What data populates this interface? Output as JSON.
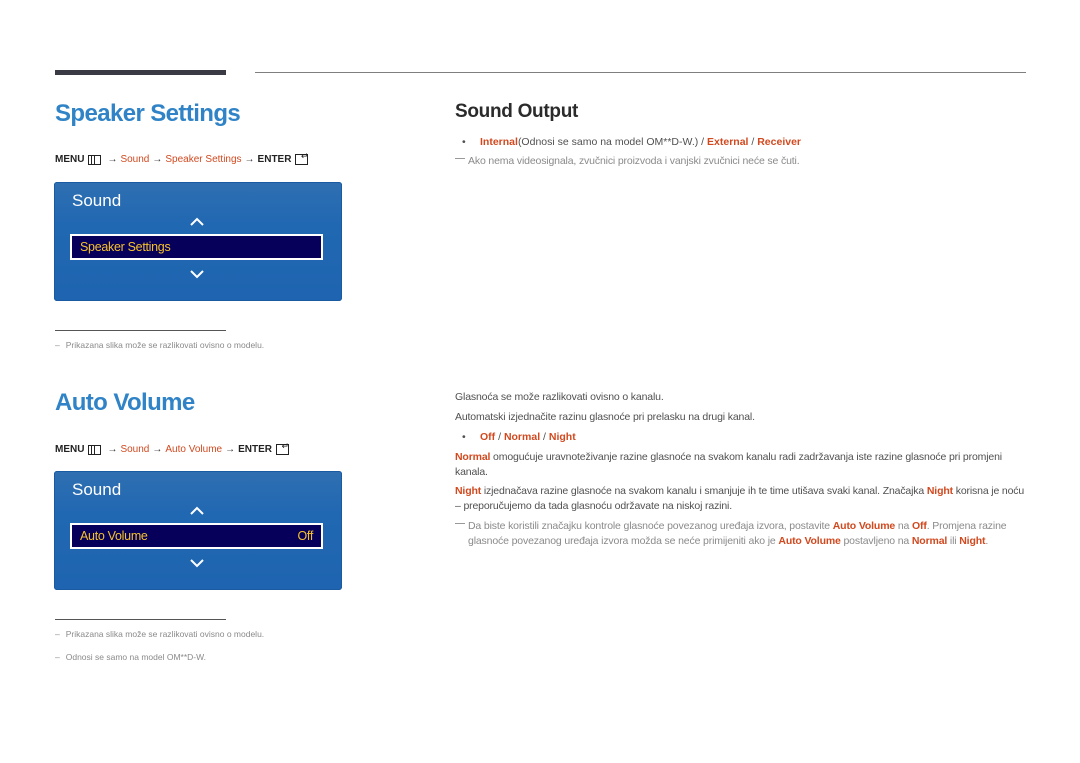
{
  "speaker_settings": {
    "title": "Speaker Settings",
    "menu_path": {
      "menu": "MENU",
      "arrow": "→",
      "sound": "Sound",
      "item": "Speaker Settings",
      "enter": "ENTER"
    },
    "osd": {
      "title": "Sound",
      "selected_item": "Speaker Settings",
      "selected_value": ""
    },
    "footnotes": [
      "Prikazana slika može se razlikovati ovisno o modelu."
    ]
  },
  "sound_output": {
    "title": "Sound Output",
    "options": {
      "internal": "Internal",
      "internal_note": "(Odnosi se samo na model OM**D-W.)",
      "sep": " / ",
      "external": "External",
      "receiver": "Receiver"
    },
    "note": "Ako nema videosignala, zvučnici proizvoda i vanjski zvučnici neće se čuti."
  },
  "auto_volume": {
    "title": "Auto Volume",
    "menu_path": {
      "menu": "MENU",
      "arrow": "→",
      "sound": "Sound",
      "item": "Auto Volume",
      "enter": "ENTER"
    },
    "osd": {
      "title": "Sound",
      "selected_item": "Auto Volume",
      "selected_value": "Off"
    },
    "footnotes": [
      "Prikazana slika može se razlikovati ovisno o modelu.",
      "Odnosi se samo na model OM**D-W."
    ],
    "desc1": "Glasnoća se može razlikovati ovisno o kanalu.",
    "desc2": "Automatski izjednačite razinu glasnoće pri prelasku na drugi kanal.",
    "options": {
      "off": "Off",
      "normal": "Normal",
      "night": "Night",
      "sep": " / "
    },
    "normal_para": {
      "term": "Normal",
      "text": " omogućuje uravnoteživanje razine glasnoće na svakom kanalu radi zadržavanja iste razine glasnoće pri promjeni kanala."
    },
    "night_para": {
      "term": "Night",
      "text1": " izjednačava razine glasnoće na svakom kanalu i smanjuje ih te time utišava svaki kanal. Značajka ",
      "term2": "Night",
      "text2": " korisna je noću – preporučujemo da tada glasnoću održavate na niskoj razini."
    },
    "note": {
      "t1": "Da biste koristili značajku kontrole glasnoće povezanog uređaja izvora, postavite ",
      "auto_volume": "Auto Volume",
      "t2": " na ",
      "off": "Off",
      "t3": ". Promjena razine glasnoće povezanog uređaja izvora možda se neće primijeniti ako je ",
      "auto_volume2": "Auto Volume",
      "t4": " postavljeno na ",
      "normal": "Normal",
      "t5": " ili ",
      "night": "Night",
      "t6": "."
    }
  },
  "colors": {
    "heading_blue": "#2f83c6",
    "accent_orange": "#d1491f",
    "osd_blue": "#2168b2",
    "osd_selection": "#07005a",
    "osd_selected_text": "#f5c12b"
  }
}
